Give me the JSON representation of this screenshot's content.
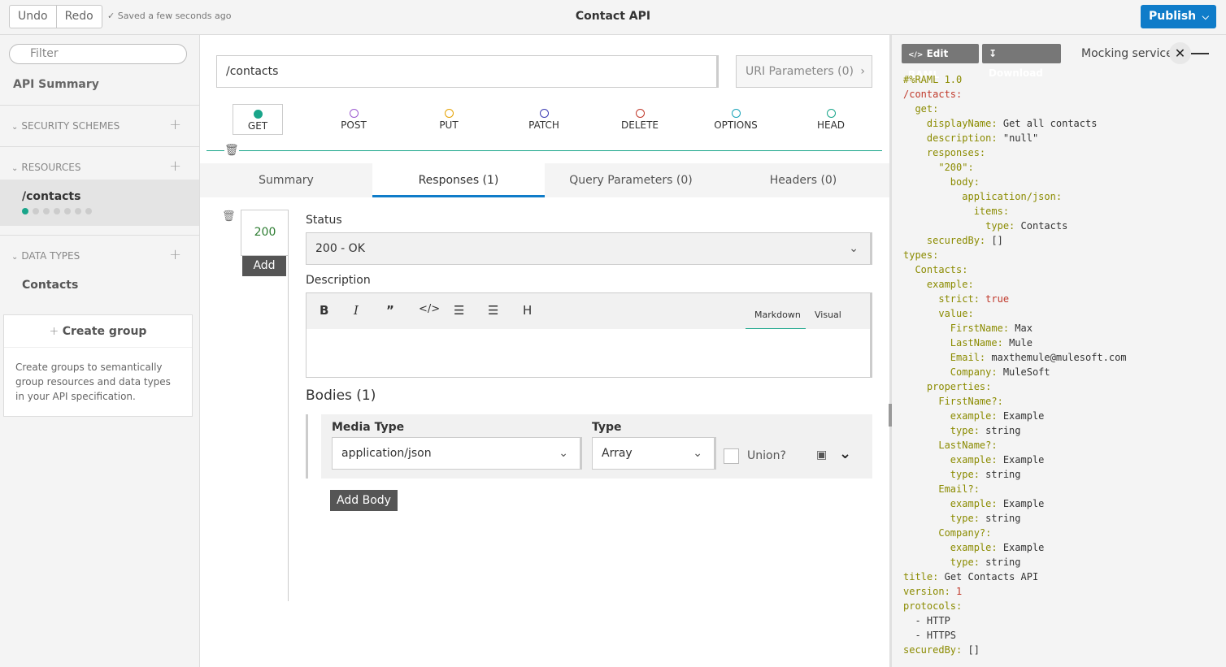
{
  "topbar": {
    "undo": "Undo",
    "redo": "Redo",
    "saved": "✓ Saved a few seconds ago",
    "title": "Contact API",
    "publish": "Publish"
  },
  "sidebar": {
    "filter_placeholder": "Filter",
    "api_summary": "API Summary",
    "security_schemes": "SECURITY SCHEMES",
    "resources": "RESOURCES",
    "resource_item": "/contacts",
    "data_types": "DATA TYPES",
    "data_type_item": "Contacts",
    "create_group": "Create group",
    "create_group_desc": "Create groups to semantically group resources and data types in your API specification."
  },
  "resource": {
    "path": "/contacts",
    "uri_params": "URI Parameters (0)",
    "methods": [
      "GET",
      "POST",
      "PUT",
      "PATCH",
      "DELETE",
      "OPTIONS",
      "HEAD"
    ],
    "method_colors": [
      "#19a58a",
      "#9b59d0",
      "#e5a100",
      "#3b3bb3",
      "#c0392b",
      "#17a2b8",
      "#19a58a"
    ],
    "active_method": "GET",
    "tabs": [
      "Summary",
      "Responses (1)",
      "Query Parameters (0)",
      "Headers (0)"
    ],
    "active_tab": "Responses (1)"
  },
  "response": {
    "code": "200",
    "add": "Add",
    "status_label": "Status",
    "status_value": "200 - OK",
    "description_label": "Description",
    "markdown": "Markdown",
    "visual": "Visual",
    "bodies_title": "Bodies (1)",
    "media_type_label": "Media Type",
    "media_type_value": "application/json",
    "type_label": "Type",
    "type_value": "Array",
    "union": "Union?",
    "add_body": "Add Body"
  },
  "raml_panel": {
    "edit_raml": "Edit RAML",
    "download": "Download",
    "mocking_service": "Mocking service"
  },
  "colors": {
    "accent": "#0f7cc9",
    "teal": "#19a58a"
  }
}
